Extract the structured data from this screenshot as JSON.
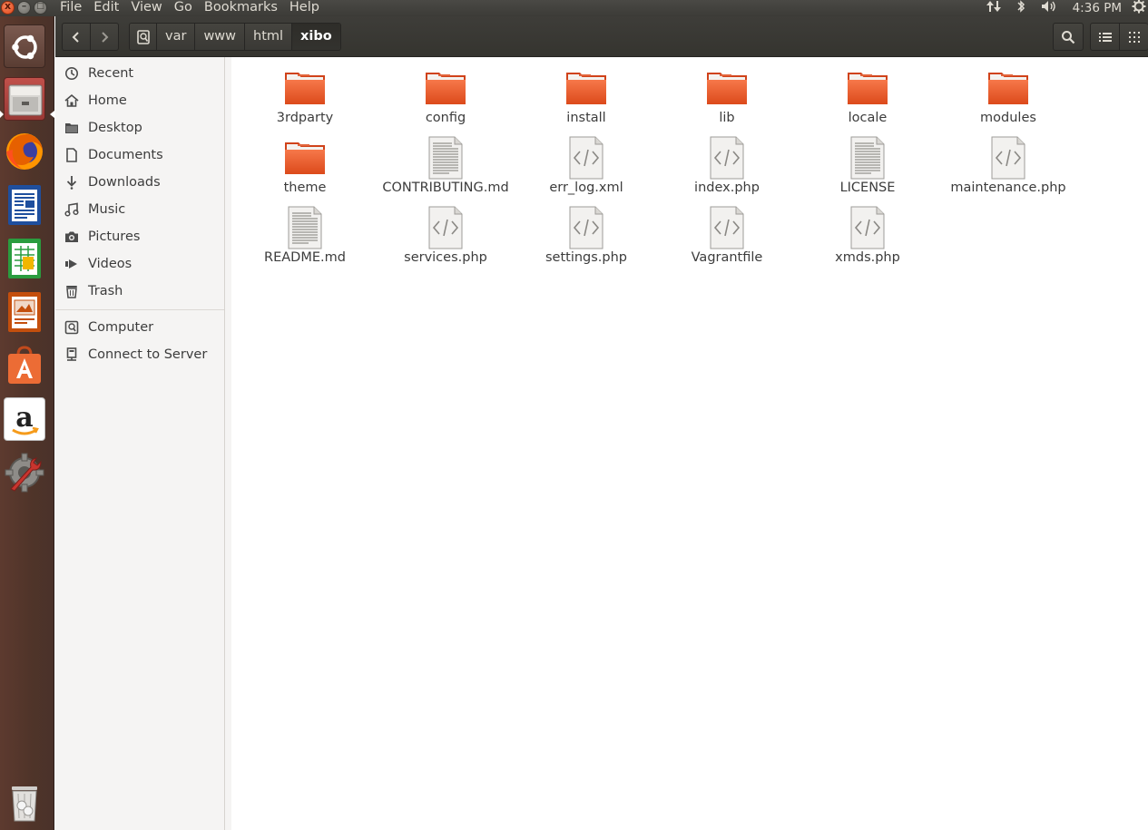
{
  "window": {
    "controls": {
      "close": "x",
      "minimize": "–",
      "maximize": "□"
    }
  },
  "menubar": {
    "items": [
      "File",
      "Edit",
      "View",
      "Go",
      "Bookmarks",
      "Help"
    ]
  },
  "indicators": {
    "network_icon": "network-updown-icon",
    "bluetooth_icon": "bluetooth-icon",
    "sound_icon": "volume-icon",
    "clock": "4:36 PM",
    "settings_icon": "gear-icon"
  },
  "launcher": {
    "apps": [
      {
        "name": "ubuntu-dash",
        "icon": "ubuntu-logo-icon"
      },
      {
        "name": "files",
        "icon": "file-cabinet-icon"
      },
      {
        "name": "firefox",
        "icon": "firefox-icon"
      },
      {
        "name": "libreoffice-writer",
        "icon": "writer-icon"
      },
      {
        "name": "libreoffice-calc",
        "icon": "calc-icon"
      },
      {
        "name": "libreoffice-impress",
        "icon": "impress-icon"
      },
      {
        "name": "ubuntu-software",
        "icon": "software-bag-icon"
      },
      {
        "name": "amazon",
        "icon": "amazon-icon"
      },
      {
        "name": "system-settings",
        "icon": "settings-wrench-icon"
      },
      {
        "name": "trash",
        "icon": "trash-icon"
      }
    ]
  },
  "pathbar": {
    "crumbs": [
      "var",
      "www",
      "html",
      "xibo"
    ],
    "active": "xibo"
  },
  "sidebar": {
    "places": [
      {
        "label": "Recent",
        "icon": "clock-icon"
      },
      {
        "label": "Home",
        "icon": "home-icon"
      },
      {
        "label": "Desktop",
        "icon": "folder-icon"
      },
      {
        "label": "Documents",
        "icon": "document-icon"
      },
      {
        "label": "Downloads",
        "icon": "download-icon"
      },
      {
        "label": "Music",
        "icon": "music-icon"
      },
      {
        "label": "Pictures",
        "icon": "camera-icon"
      },
      {
        "label": "Videos",
        "icon": "video-icon"
      },
      {
        "label": "Trash",
        "icon": "trash-icon"
      }
    ],
    "devices": [
      {
        "label": "Computer",
        "icon": "drive-icon"
      },
      {
        "label": "Connect to Server",
        "icon": "network-server-icon"
      }
    ]
  },
  "files": [
    {
      "name": "3rdparty",
      "type": "folder"
    },
    {
      "name": "config",
      "type": "folder"
    },
    {
      "name": "install",
      "type": "folder"
    },
    {
      "name": "lib",
      "type": "folder"
    },
    {
      "name": "locale",
      "type": "folder"
    },
    {
      "name": "modules",
      "type": "folder"
    },
    {
      "name": "theme",
      "type": "folder"
    },
    {
      "name": "CONTRIBUTING.md",
      "type": "text"
    },
    {
      "name": "err_log.xml",
      "type": "code"
    },
    {
      "name": "index.php",
      "type": "code"
    },
    {
      "name": "LICENSE",
      "type": "text"
    },
    {
      "name": "maintenance.php",
      "type": "code"
    },
    {
      "name": "README.md",
      "type": "text"
    },
    {
      "name": "services.php",
      "type": "code"
    },
    {
      "name": "settings.php",
      "type": "code"
    },
    {
      "name": "Vagrantfile",
      "type": "code"
    },
    {
      "name": "xmds.php",
      "type": "code"
    }
  ],
  "colors": {
    "accent_orange": "#e95420",
    "panel_dark": "#3c3b37",
    "launcher_brown": "#55382d"
  }
}
